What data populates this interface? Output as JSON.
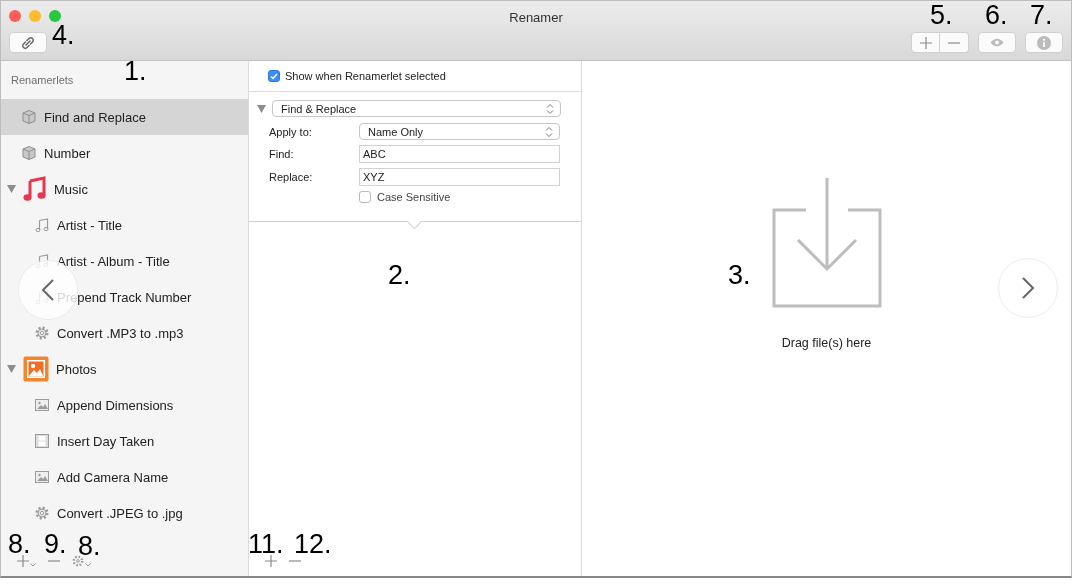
{
  "window": {
    "title": "Renamer"
  },
  "sidebar": {
    "header": "Renamerlets",
    "items": [
      {
        "kind": "cube",
        "label": "Find and Replace",
        "selected": true
      },
      {
        "kind": "cube",
        "label": "Number",
        "selected": false
      },
      {
        "kind": "music",
        "label": "Music",
        "selected": false,
        "expanded": true,
        "children": [
          {
            "kind": "note",
            "label": "Artist - Title",
            "selected": false
          },
          {
            "kind": "note",
            "label": "Artist - Album - Title",
            "selected": false
          },
          {
            "kind": "note",
            "label": "Prepend Track Number",
            "selected": false
          },
          {
            "kind": "gear",
            "label": "Convert .MP3 to .mp3",
            "selected": false
          }
        ]
      },
      {
        "kind": "photos",
        "label": "Photos",
        "selected": false,
        "expanded": true,
        "children": [
          {
            "kind": "image",
            "label": "Append Dimensions",
            "selected": false
          },
          {
            "kind": "film",
            "label": "Insert Day Taken",
            "selected": false
          },
          {
            "kind": "image",
            "label": "Add Camera Name",
            "selected": false
          },
          {
            "kind": "gear",
            "label": "Convert .JPEG to .jpg",
            "selected": false
          }
        ]
      }
    ]
  },
  "editor": {
    "show_option": {
      "label": "Show when Renamerlet selected",
      "checked": true
    },
    "renamerlet": {
      "title": "Find & Replace",
      "expanded": true,
      "apply_to": {
        "label": "Apply to:",
        "value": "Name Only"
      },
      "find": {
        "label": "Find:",
        "value": "ABC"
      },
      "replace": {
        "label": "Replace:",
        "value": "XYZ"
      },
      "case_sensitive": {
        "label": "Case Sensitive",
        "checked": false
      }
    }
  },
  "drop_zone": {
    "text": "Drag file(s) here"
  },
  "annotations": [
    "1.",
    "2.",
    "3.",
    "4.",
    "5.",
    "6.",
    "7.",
    "8.",
    "9.",
    "8.",
    "11.",
    "12."
  ]
}
